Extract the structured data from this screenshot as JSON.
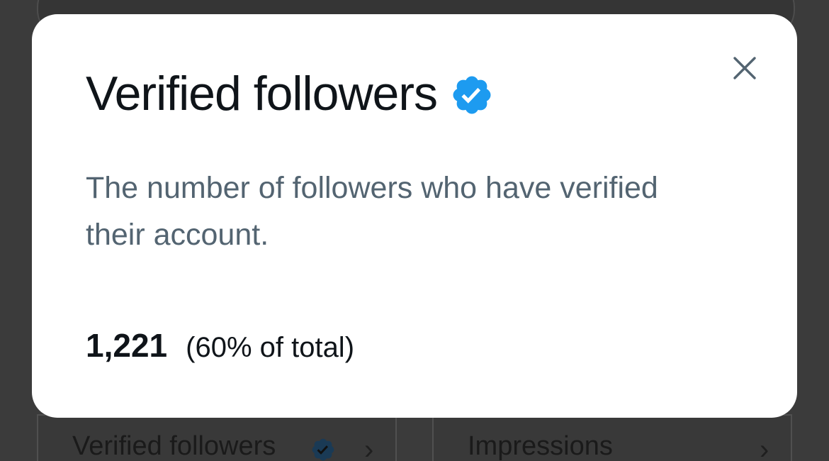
{
  "modal": {
    "title": "Verified followers",
    "description": "The number of followers who have verified their account.",
    "count": "1,221",
    "share": "(60% of total)",
    "badge_icon": "verified-badge-icon",
    "close_icon": "close-icon"
  },
  "background": {
    "cells": [
      {
        "label": "Verified followers",
        "has_badge": true
      },
      {
        "label": "Impressions",
        "has_badge": false
      }
    ]
  },
  "colors": {
    "badge_blue": "#1d9bf0",
    "title_text": "#0f1419",
    "secondary_text": "#536471",
    "overlay": "#3b3b3b"
  }
}
